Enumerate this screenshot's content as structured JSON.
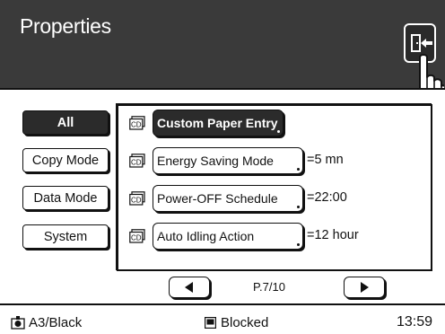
{
  "header": {
    "title": "Properties"
  },
  "sidebar": {
    "items": [
      {
        "label": "All",
        "active": true
      },
      {
        "label": "Copy Mode",
        "active": false
      },
      {
        "label": "Data Mode",
        "active": false
      },
      {
        "label": "System",
        "active": false
      }
    ]
  },
  "settings": {
    "rows": [
      {
        "icon": "cd-icon",
        "label": "Custom Paper Entry",
        "value": "",
        "active": true
      },
      {
        "icon": "cd-icon",
        "label": "Energy Saving Mode",
        "value": "=5 mn",
        "active": false
      },
      {
        "icon": "cd-icon",
        "label": "Power-OFF Schedule",
        "value": "=22:00",
        "active": false
      },
      {
        "icon": "cd-icon",
        "label": "Auto Idling Action",
        "value": "=12 hour",
        "active": false
      }
    ]
  },
  "pagination": {
    "page_text": "P.7/10"
  },
  "status_bar": {
    "paper": "A3/Black",
    "state": "Blocked",
    "time": "13:59"
  },
  "colors": {
    "header_bg": "#3a3a3a",
    "active_bg": "#2b2b2b"
  }
}
